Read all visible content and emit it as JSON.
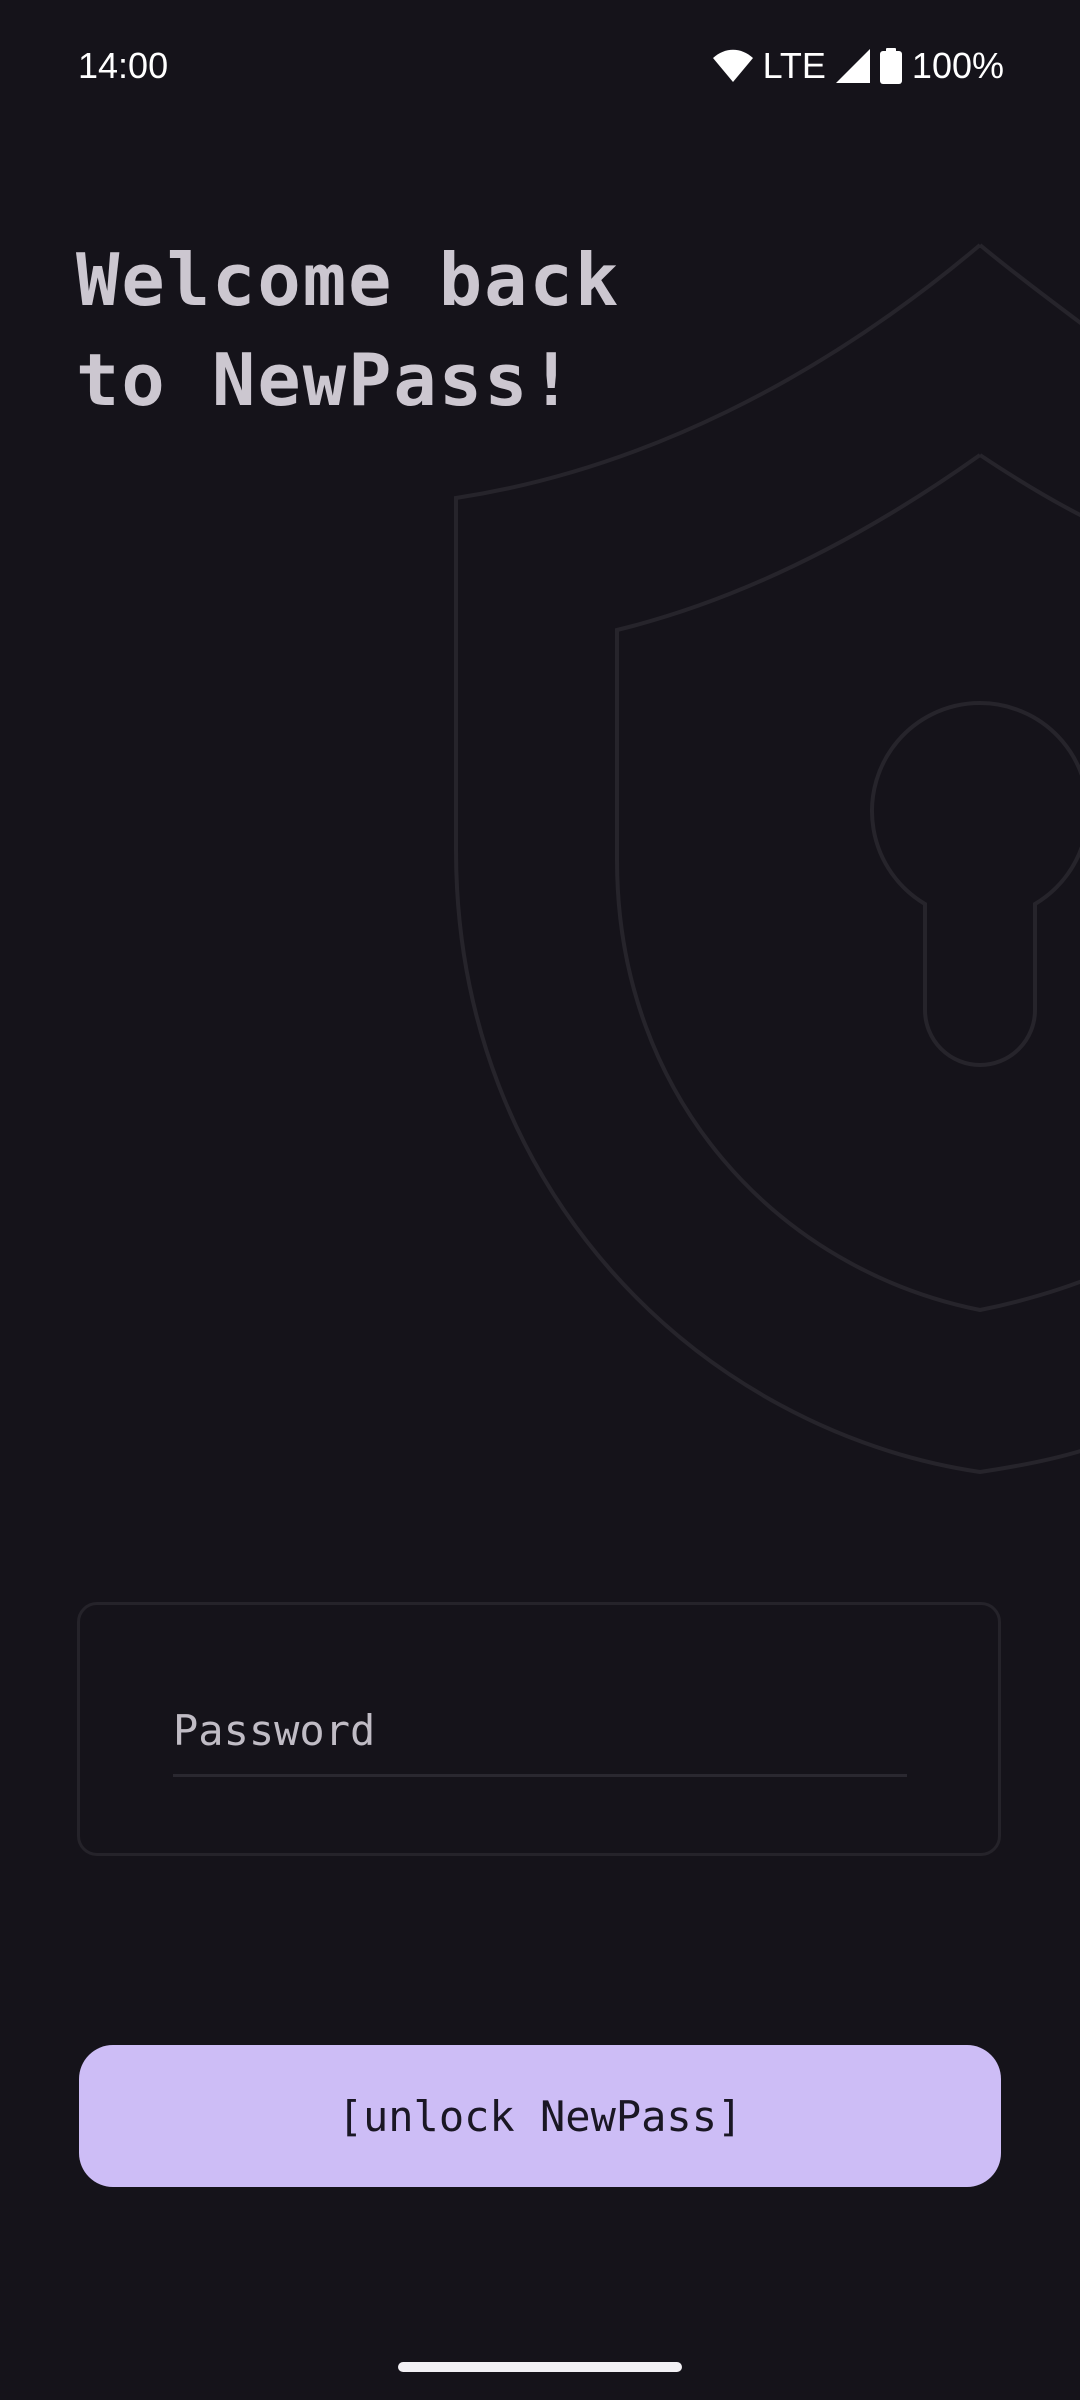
{
  "status_bar": {
    "time": "14:00",
    "network": "LTE",
    "battery": "100%",
    "icons": [
      "wifi-icon",
      "cell-signal-icon",
      "battery-icon"
    ]
  },
  "background": {
    "illustration": "shield-keyhole-icon",
    "stroke_color": "#2a2830"
  },
  "welcome": {
    "line1": "Welcome back",
    "line2": "to NewPass!"
  },
  "password": {
    "placeholder": "Password",
    "value": ""
  },
  "unlock_button": {
    "label": "[unlock NewPass]",
    "color": "#cdbdf6"
  },
  "colors": {
    "background": "#15131a",
    "text": "#ccc7d0",
    "accent": "#cdbdf6"
  }
}
